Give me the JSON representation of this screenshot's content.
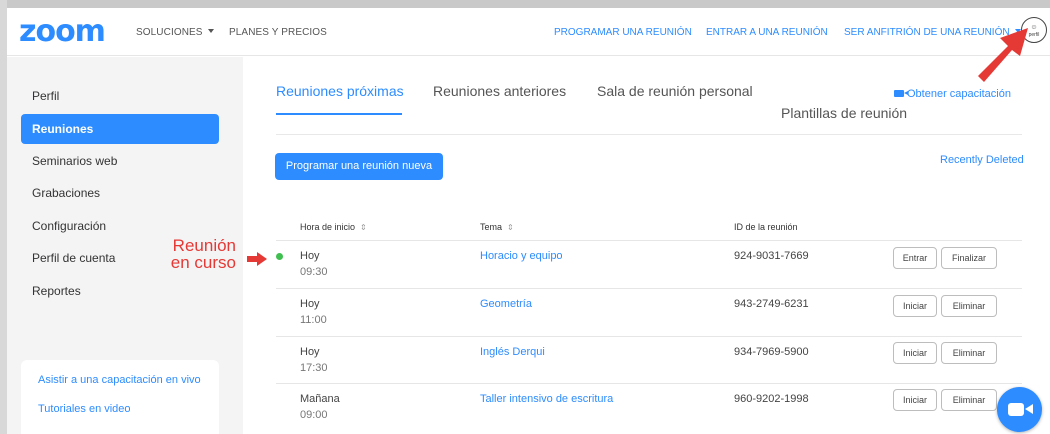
{
  "header": {
    "logo": "zoom",
    "nav_left": [
      "SOLUCIONES",
      "PLANES Y PRECIOS"
    ],
    "nav_right": [
      "PROGRAMAR UNA REUNIÓN",
      "ENTRAR A UNA REUNIÓN",
      "SER ANFITRIÓN DE UNA REUNIÓN"
    ],
    "avatar_text": "perfil"
  },
  "sidebar": {
    "items": [
      {
        "label": "Perfil"
      },
      {
        "label": "Reuniones"
      },
      {
        "label": "Seminarios web"
      },
      {
        "label": "Grabaciones"
      },
      {
        "label": "Configuración"
      },
      {
        "label": "Perfil de cuenta"
      },
      {
        "label": "Reportes"
      }
    ],
    "active": "Reuniones",
    "links": [
      "Asistir a una capacitación en vivo",
      "Tutoriales en video"
    ]
  },
  "annotation": {
    "line1": "Reunión",
    "line2": "en curso"
  },
  "tabs": [
    "Reuniones próximas",
    "Reuniones anteriores",
    "Sala de reunión personal",
    "Plantillas de reunión"
  ],
  "training_link": "Obtener capacitación",
  "schedule_button": "Programar una reunión nueva",
  "recently_deleted": "Recently Deleted",
  "table": {
    "headers": [
      "Hora de inicio",
      "Tema",
      "ID de la reunión"
    ],
    "sort_glyph": "⇕",
    "rows": [
      {
        "day": "Hoy",
        "time": "09:30",
        "topic": "Horacio y equipo",
        "id": "924-9031-7669",
        "btn1": "Entrar",
        "btn2": "Finalizar"
      },
      {
        "day": "Hoy",
        "time": "11:00",
        "topic": "Geometría",
        "id": "943-2749-6231",
        "btn1": "Iniciar",
        "btn2": "Eliminar"
      },
      {
        "day": "Hoy",
        "time": "17:30",
        "topic": "Inglés Derqui",
        "id": "934-7969-5900",
        "btn1": "Iniciar",
        "btn2": "Eliminar"
      },
      {
        "day": "Mañana",
        "time": "09:00",
        "topic": "Taller intensivo de escritura",
        "id": "960-9202-1998",
        "btn1": "Iniciar",
        "btn2": "Eliminar"
      }
    ]
  },
  "colors": {
    "accent": "#2d8cff",
    "annotation": "#e53935",
    "live": "#3fbf4f"
  }
}
